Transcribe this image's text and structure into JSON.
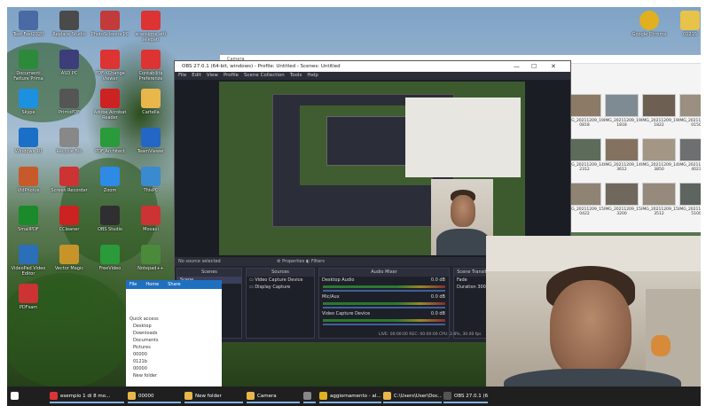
{
  "desktop_icons": [
    {
      "label": "Text Fast2020",
      "color": "#4a6aa3",
      "icon": "document-icon"
    },
    {
      "label": "Replace Studio",
      "color": "#4a4a4a",
      "icon": "app-icon"
    },
    {
      "label": "PhotoScissors PC",
      "color": "#c23a3a",
      "icon": "scissors-icon"
    },
    {
      "label": "scansione atti allegati",
      "color": "#d33",
      "icon": "pdf-icon"
    },
    {
      "label": "Documenti Fatture Prima",
      "color": "#2d8a3a",
      "icon": "document-icon"
    },
    {
      "label": "ASD PC",
      "color": "#3d3d7a",
      "icon": "app-icon"
    },
    {
      "label": "PDF-XChange Viewer",
      "color": "#d33",
      "icon": "pdf-icon"
    },
    {
      "label": "Contabilità Preferenze",
      "color": "#d33",
      "icon": "pdf-icon"
    },
    {
      "label": "Skype",
      "color": "#1e90e0",
      "icon": "skype-icon"
    },
    {
      "label": "PrimoPDF",
      "color": "#555",
      "icon": "app-icon"
    },
    {
      "label": "Adobe Acrobat Reader",
      "color": "#c22",
      "icon": "acrobat-icon"
    },
    {
      "label": "Cartella",
      "color": "#e8b64a",
      "icon": "folder-icon"
    },
    {
      "label": "Windows 10",
      "color": "#1a6fc7",
      "icon": "app-icon"
    },
    {
      "label": "Recycle Bin",
      "color": "#888",
      "icon": "recycle-bin-icon"
    },
    {
      "label": "PDF Architect",
      "color": "#2a9a3a",
      "icon": "app-icon"
    },
    {
      "label": "TeamViewer",
      "color": "#2366c4",
      "icon": "app-icon"
    },
    {
      "label": "VidPhotos",
      "color": "#c65a2a",
      "icon": "app-icon"
    },
    {
      "label": "Screen Recorder",
      "color": "#c33",
      "icon": "app-icon"
    },
    {
      "label": "Zoom",
      "color": "#2d8ae5",
      "icon": "app-icon"
    },
    {
      "label": "ThisPC",
      "color": "#3a8ad0",
      "icon": "app-icon"
    },
    {
      "label": "SmallPDF",
      "color": "#1a8a2a",
      "icon": "app-icon"
    },
    {
      "label": "CCleaner",
      "color": "#c22",
      "icon": "app-icon"
    },
    {
      "label": "OBS Studio",
      "color": "#302e31",
      "icon": "obs-icon"
    },
    {
      "label": "Movavi",
      "color": "#c33",
      "icon": "app-icon"
    },
    {
      "label": "VideoPad Video Editor",
      "color": "#2b6fb8",
      "icon": "app-icon"
    },
    {
      "label": "Vector Magic",
      "color": "#c7942a",
      "icon": "app-icon"
    },
    {
      "label": "FreeVideo",
      "color": "#2a9a3a",
      "icon": "app-icon"
    },
    {
      "label": "Notepad++",
      "color": "#4a8a3a",
      "icon": "app-icon"
    },
    {
      "label": "PDFsam",
      "color": "#c33",
      "icon": "pdf-icon"
    }
  ],
  "desktop_right_icons": [
    {
      "label": "Google Chrome",
      "color": "#e0b020",
      "icon": "chrome-icon"
    },
    {
      "label": "0121S",
      "color": "#e8c34a",
      "icon": "folder-icon"
    }
  ],
  "obs": {
    "title": "OBS 27.0.1 (64-bit, windows) - Profile: Untitled - Scenes: Untitled",
    "menu": [
      "File",
      "Edit",
      "View",
      "Profile",
      "Scene Collection",
      "Tools",
      "Help"
    ],
    "no_source": "No source selected",
    "properties": "Properties",
    "filters": "Filters",
    "docks": {
      "scenes": {
        "title": "Scenes",
        "items": [
          "Scene"
        ]
      },
      "sources": {
        "title": "Sources",
        "items": [
          "Video Capture Device",
          "Display Capture"
        ]
      },
      "mixer": {
        "title": "Audio Mixer",
        "channels": [
          {
            "name": "Desktop Audio",
            "level": "0.0 dB"
          },
          {
            "name": "Mic/Aux",
            "level": "0.0 dB"
          },
          {
            "name": "Video Capture Device",
            "level": "0.0 dB"
          }
        ]
      },
      "transitions": {
        "title": "Scene Transitions",
        "mode": "Fade",
        "duration_label": "Duration",
        "duration": "300 ms"
      }
    },
    "status": "LIVE: 00:00:00   REC: 00:00:00   CPU: 2.8%, 30.00 fps"
  },
  "explorer": {
    "title": "Camera",
    "thumbs": [
      "IMG_20211209_19 0818",
      "IMG_20211209_19 1818",
      "IMG_20211209_19 1822",
      "IMG_20211209_19 0150",
      "IMG_20211209_14 2312",
      "IMG_20211209_14 3612",
      "IMG_20211209_14 3850",
      "IMG_20211209_14 4023",
      "IMG_20211209_15 0422",
      "IMG_20211209_15 3200",
      "IMG_20211209_15 3512",
      "IMG_20211209_15 5100"
    ]
  },
  "left_explorer": {
    "ribbon": [
      "File",
      "Home",
      "Share"
    ],
    "nav": [
      "Quick access",
      "Desktop",
      "Downloads",
      "Documents",
      "Pictures",
      "00000",
      "0121b",
      "00000",
      "New folder"
    ]
  },
  "taskbar": [
    {
      "label": "",
      "icon": "windows-start-icon",
      "color": "#fff"
    },
    {
      "label": "esempio 1 di 8 mo...",
      "icon": "pdf-icon",
      "color": "#d33"
    },
    {
      "label": "00000",
      "icon": "folder-icon",
      "color": "#e8b64a"
    },
    {
      "label": "New folder",
      "icon": "folder-icon",
      "color": "#e8b64a"
    },
    {
      "label": "Camera",
      "icon": "folder-icon",
      "color": "#e8b64a"
    },
    {
      "label": "",
      "icon": "app-icon",
      "color": "#888"
    },
    {
      "label": "aggiornamento - al...",
      "icon": "chrome-icon",
      "color": "#e0b020"
    },
    {
      "label": "C:\\Users\\User\\Doc...",
      "icon": "folder-icon",
      "color": "#e8b64a"
    },
    {
      "label": "OBS 27.0.1 (64",
      "icon": "obs-icon",
      "color": "#555"
    }
  ],
  "colors": {
    "obs_bg": "#2b2e38",
    "taskbar_bg": "#1f1f1f",
    "accent": "#1f6fbf"
  }
}
